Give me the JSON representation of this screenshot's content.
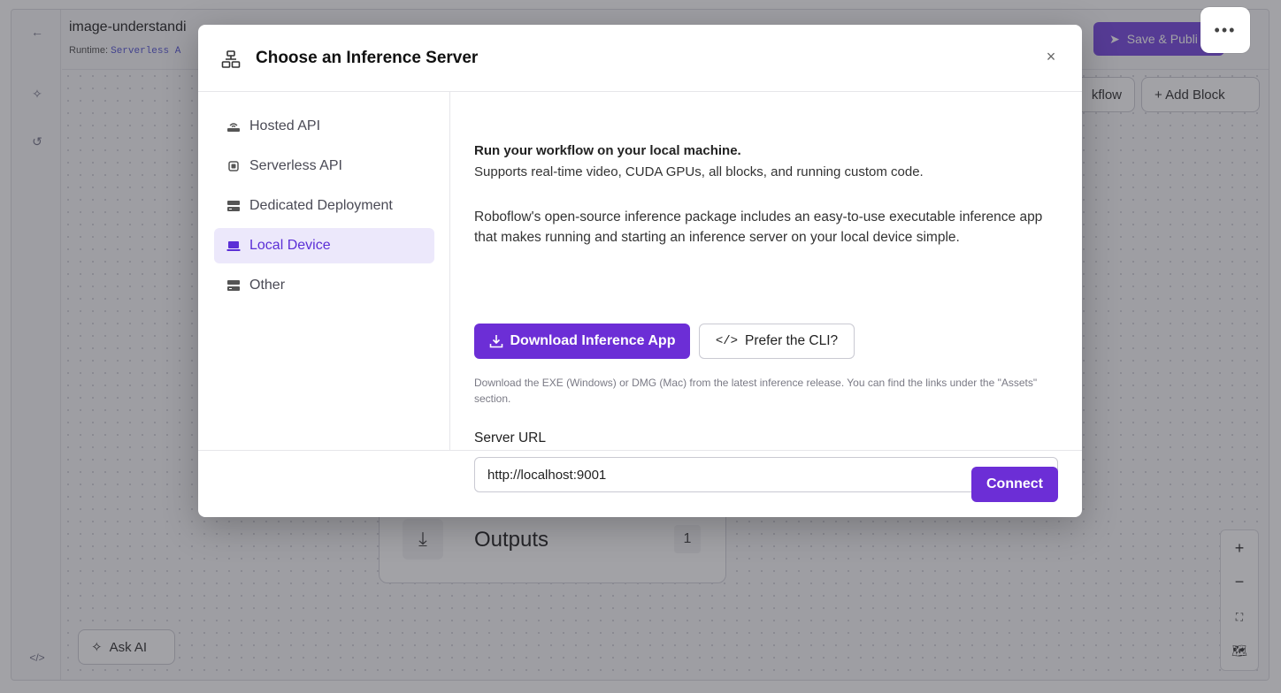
{
  "app": {
    "workflow_title": "image-understandi",
    "runtime_label": "Runtime:",
    "runtime_value": "Serverless A",
    "publish_label": "Save & Publi",
    "more_label": "•••",
    "workflow_button_label": "kflow",
    "add_block_label": "+ Add Block",
    "outputs_label": "Outputs",
    "outputs_count": "1",
    "ask_ai_label": "Ask AI",
    "code_toggle_label": "</>",
    "zoom": {
      "zoom_in": "+",
      "zoom_out": "−",
      "fit": "⛶",
      "map": "🗺"
    }
  },
  "modal": {
    "title": "Choose an Inference Server",
    "close": "×",
    "nav": [
      {
        "label": "Hosted API",
        "icon": "router-icon",
        "active": false
      },
      {
        "label": "Serverless API",
        "icon": "chip-icon",
        "active": false
      },
      {
        "label": "Dedicated Deployment",
        "icon": "server-icon",
        "active": false
      },
      {
        "label": "Local Device",
        "icon": "laptop-icon",
        "active": true
      },
      {
        "label": "Other",
        "icon": "server-icon",
        "active": false
      }
    ],
    "content": {
      "heading": "Run your workflow on your local machine.",
      "subheading": "Supports real-time video, CUDA GPUs, all blocks, and running custom code.",
      "paragraph": "Roboflow's open-source inference package includes an easy-to-use executable inference app that makes running and starting an inference server on your local device simple.",
      "download_button": "Download Inference App",
      "cli_button": "Prefer the CLI?",
      "note": "Download the EXE (Windows) or DMG (Mac) from the latest inference release. You can find the links under the \"Assets\" section.",
      "server_url_label": "Server URL",
      "server_url_value": "http://localhost:9001"
    },
    "connect_button": "Connect"
  },
  "colors": {
    "accent": "#6c2ed6",
    "accent_light": "#ece8fb",
    "overlay": "rgba(60,60,70,0.48)"
  }
}
